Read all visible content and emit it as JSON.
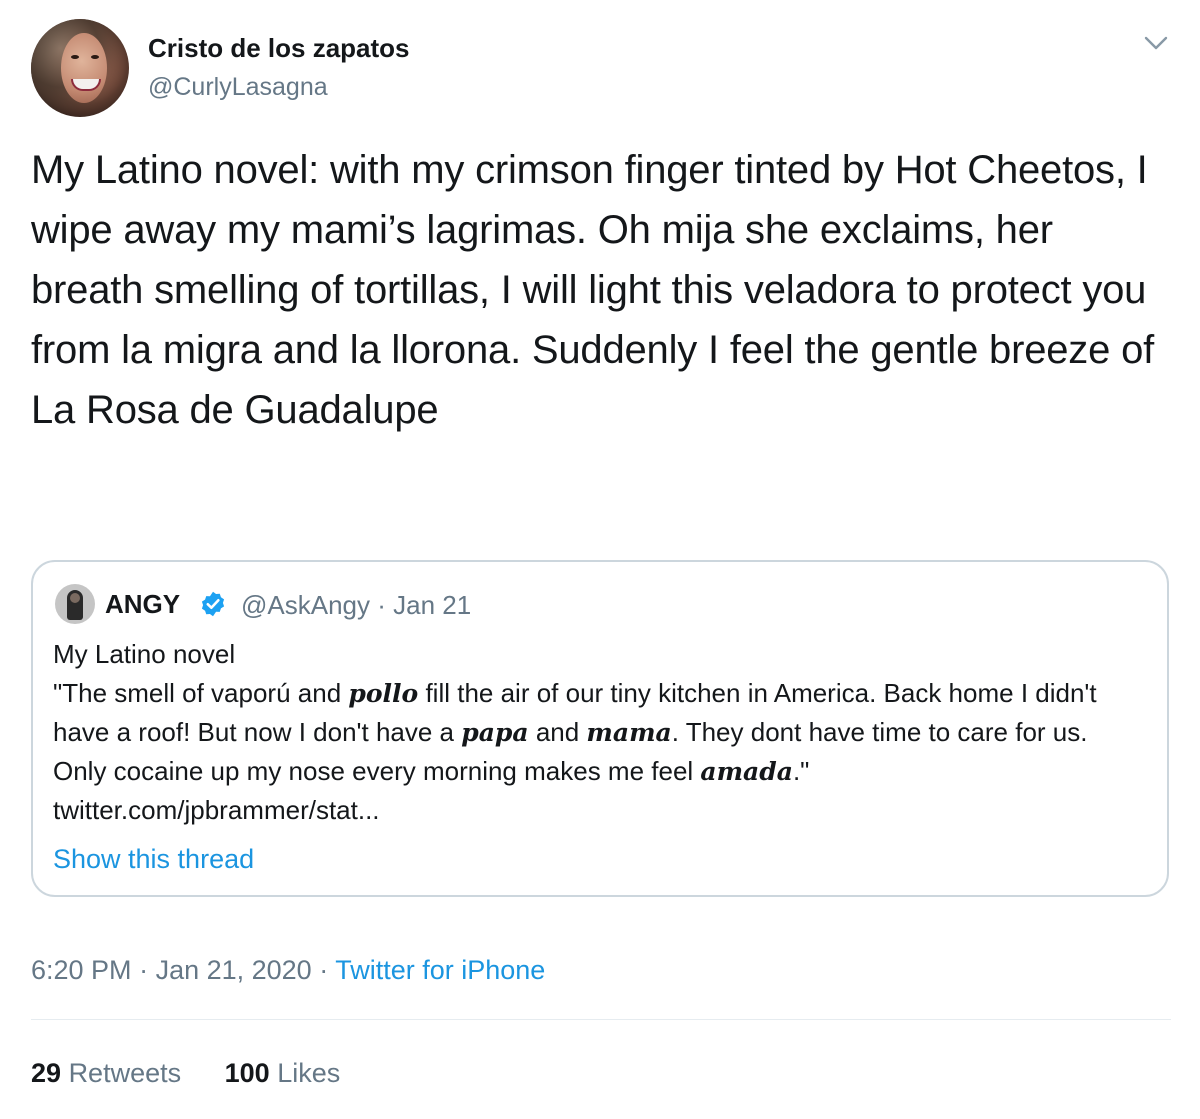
{
  "author": {
    "name": "Cristo de los zapatos",
    "handle": "@CurlyLasagna"
  },
  "tweet": {
    "text": "My Latino novel: with my crimson finger tinted by Hot Cheetos, I wipe away my mami’s lagrimas. Oh mija she exclaims, her breath smelling of tortillas, I will light this veladora to protect you from la migra and la llorona. Suddenly I feel the gentle breeze of La Rosa de Guadalupe"
  },
  "quoted": {
    "name": "ANGY",
    "handle": "@AskAngy",
    "date": "Jan 21",
    "line1": "My Latino novel",
    "p1": "\"The smell of vaporú and ",
    "w1": "pollo",
    "p2": "  fill the air of our tiny kitchen in America. Back home I didn't have a roof! But now I don't have a ",
    "w2": "papa",
    "p3": " and ",
    "w3": "mama",
    "p4": ". They dont have time to care for us. Only cocaine up my nose every morning makes me feel ",
    "w4": "amada",
    "p5": ".\" twitter.com/jpbrammer/stat...",
    "show_thread": "Show this thread"
  },
  "meta": {
    "time": "6:20 PM",
    "date": "Jan 21, 2020",
    "source": "Twitter for iPhone",
    "separator": " · "
  },
  "stats": {
    "retweets_count": "29",
    "retweets_label": "Retweets",
    "likes_count": "100",
    "likes_label": "Likes"
  },
  "icons": {
    "caret": "chevron-down-icon",
    "verified": "verified-badge-icon"
  },
  "colors": {
    "link": "#1b95e0",
    "muted": "#657786",
    "border": "#ccd6dd"
  }
}
